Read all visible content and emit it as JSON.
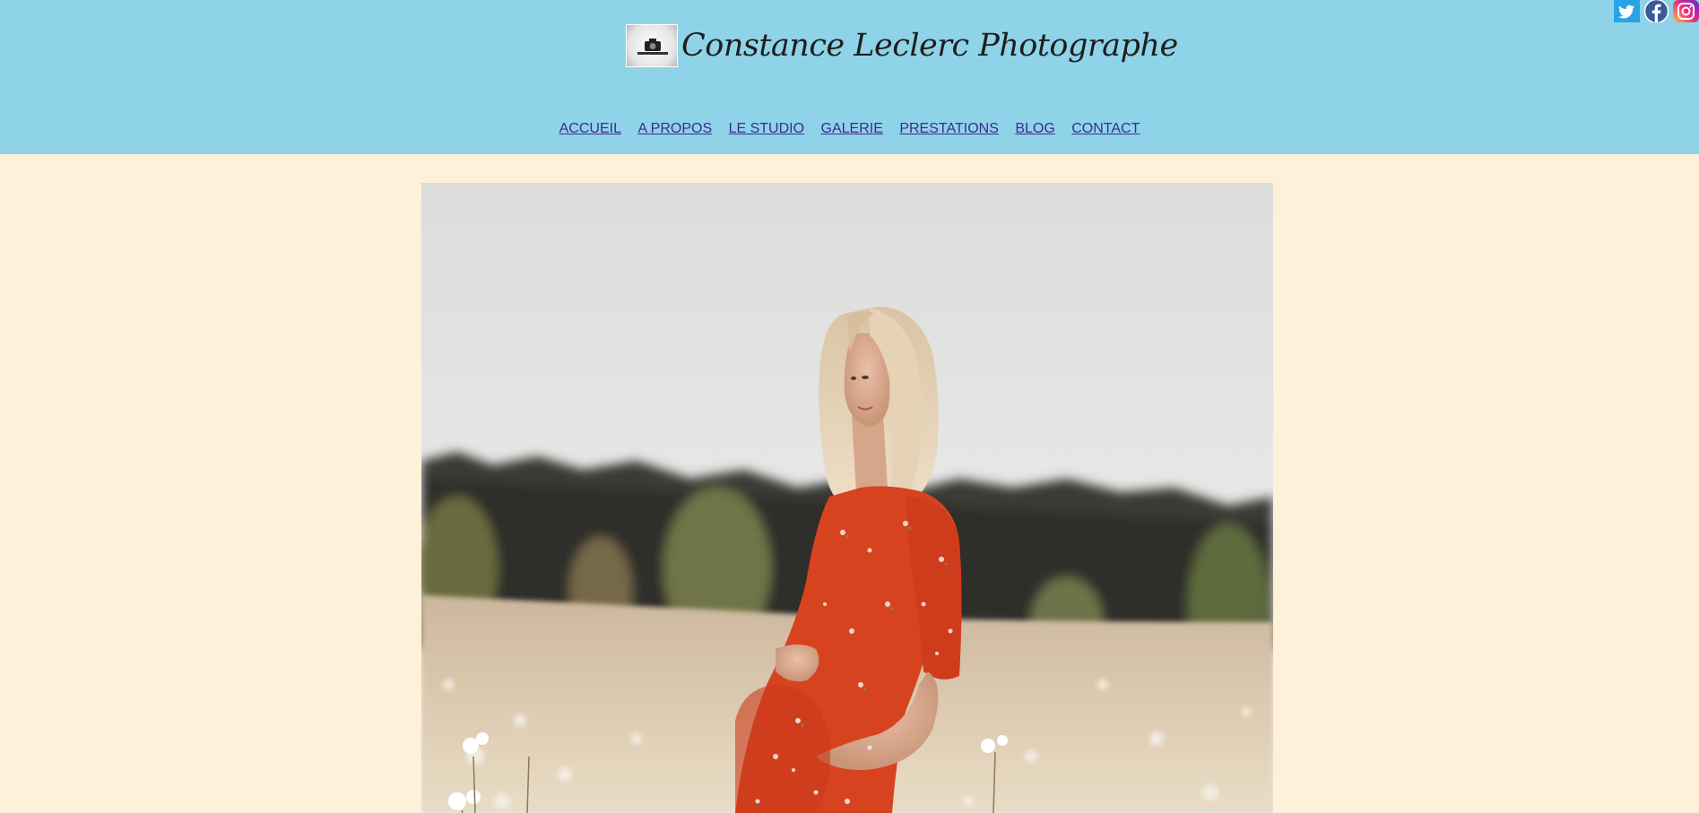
{
  "site": {
    "title": "Constance Leclerc Photographe"
  },
  "nav": {
    "items": [
      {
        "label": "ACCUEIL"
      },
      {
        "label": "A PROPOS"
      },
      {
        "label": "LE STUDIO"
      },
      {
        "label": "GALERIE"
      },
      {
        "label": "PRESTATIONS"
      },
      {
        "label": "BLOG"
      },
      {
        "label": "CONTACT"
      }
    ]
  },
  "social": {
    "icons": [
      "twitter-icon",
      "facebook-icon",
      "instagram-icon"
    ]
  },
  "colors": {
    "header_bg": "#8fd3e8",
    "page_bg": "#fff0d9",
    "nav_link": "#3b2b8f",
    "dress": "#d8431f"
  }
}
